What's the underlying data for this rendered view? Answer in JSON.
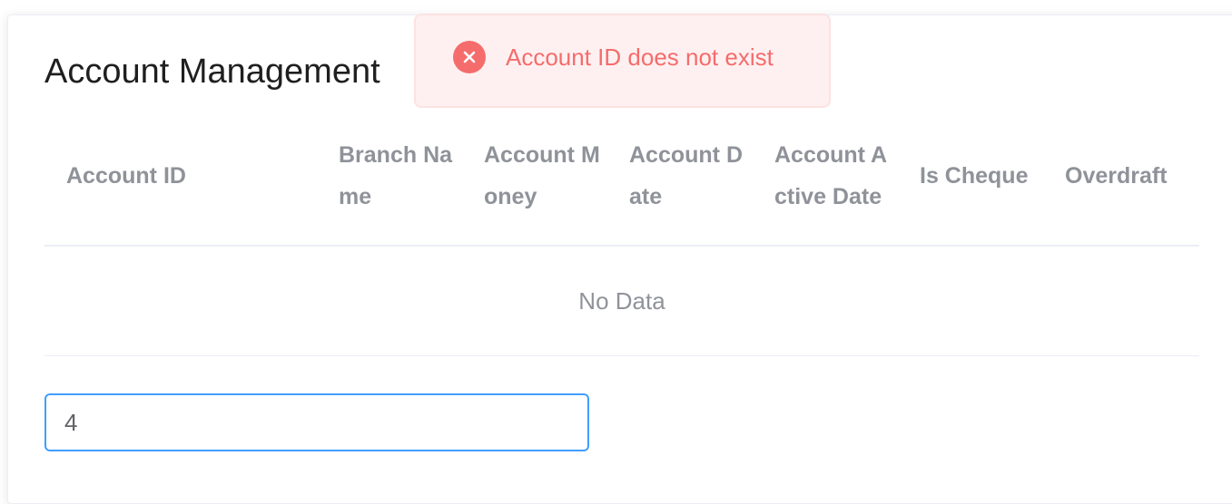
{
  "page": {
    "title": "Account Management"
  },
  "table": {
    "columns": [
      "Account ID",
      "Branch Name",
      "Account Money",
      "Account Date",
      "Account Active Date",
      "Is Cheque",
      "Overdraft"
    ],
    "empty_text": "No Data"
  },
  "search": {
    "value": "4"
  },
  "toast": {
    "type": "error",
    "message": "Account ID does not exist",
    "icon": "error-circle-icon",
    "color": "#f56c6c",
    "background": "#fef0f0"
  },
  "colors": {
    "accent": "#409eff",
    "header_text": "#8f9299",
    "border": "#ebeef5"
  }
}
